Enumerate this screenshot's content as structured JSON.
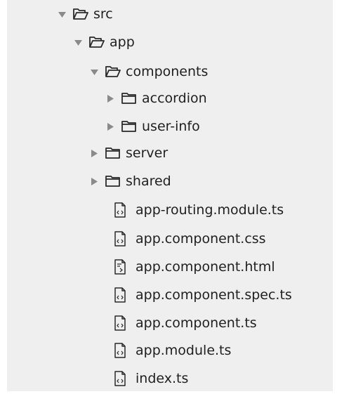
{
  "tree": {
    "src": {
      "label": "src",
      "icon": "folder-open-icon",
      "state": "expanded"
    },
    "app": {
      "label": "app",
      "icon": "folder-open-icon",
      "state": "expanded"
    },
    "components": {
      "label": "components",
      "icon": "folder-open-icon",
      "state": "expanded"
    },
    "accordion": {
      "label": "accordion",
      "icon": "folder-icon",
      "state": "collapsed"
    },
    "user_info": {
      "label": "user-info",
      "icon": "folder-icon",
      "state": "collapsed"
    },
    "server": {
      "label": "server",
      "icon": "folder-icon",
      "state": "collapsed"
    },
    "shared": {
      "label": "shared",
      "icon": "folder-icon",
      "state": "collapsed"
    },
    "files": [
      {
        "label": "app-routing.module.ts",
        "icon": "code-file-icon"
      },
      {
        "label": "app.component.css",
        "icon": "code-file-icon"
      },
      {
        "label": "app.component.html",
        "icon": "markup-file-icon"
      },
      {
        "label": "app.component.spec.ts",
        "icon": "code-file-icon"
      },
      {
        "label": "app.component.ts",
        "icon": "code-file-icon"
      },
      {
        "label": "app.module.ts",
        "icon": "code-file-icon"
      },
      {
        "label": "index.ts",
        "icon": "code-file-icon"
      }
    ]
  },
  "colors": {
    "background": "#efefef",
    "arrow": "#8a8a8a",
    "icon_stroke": "#2a2a2a",
    "text": "#1f1f1f"
  }
}
